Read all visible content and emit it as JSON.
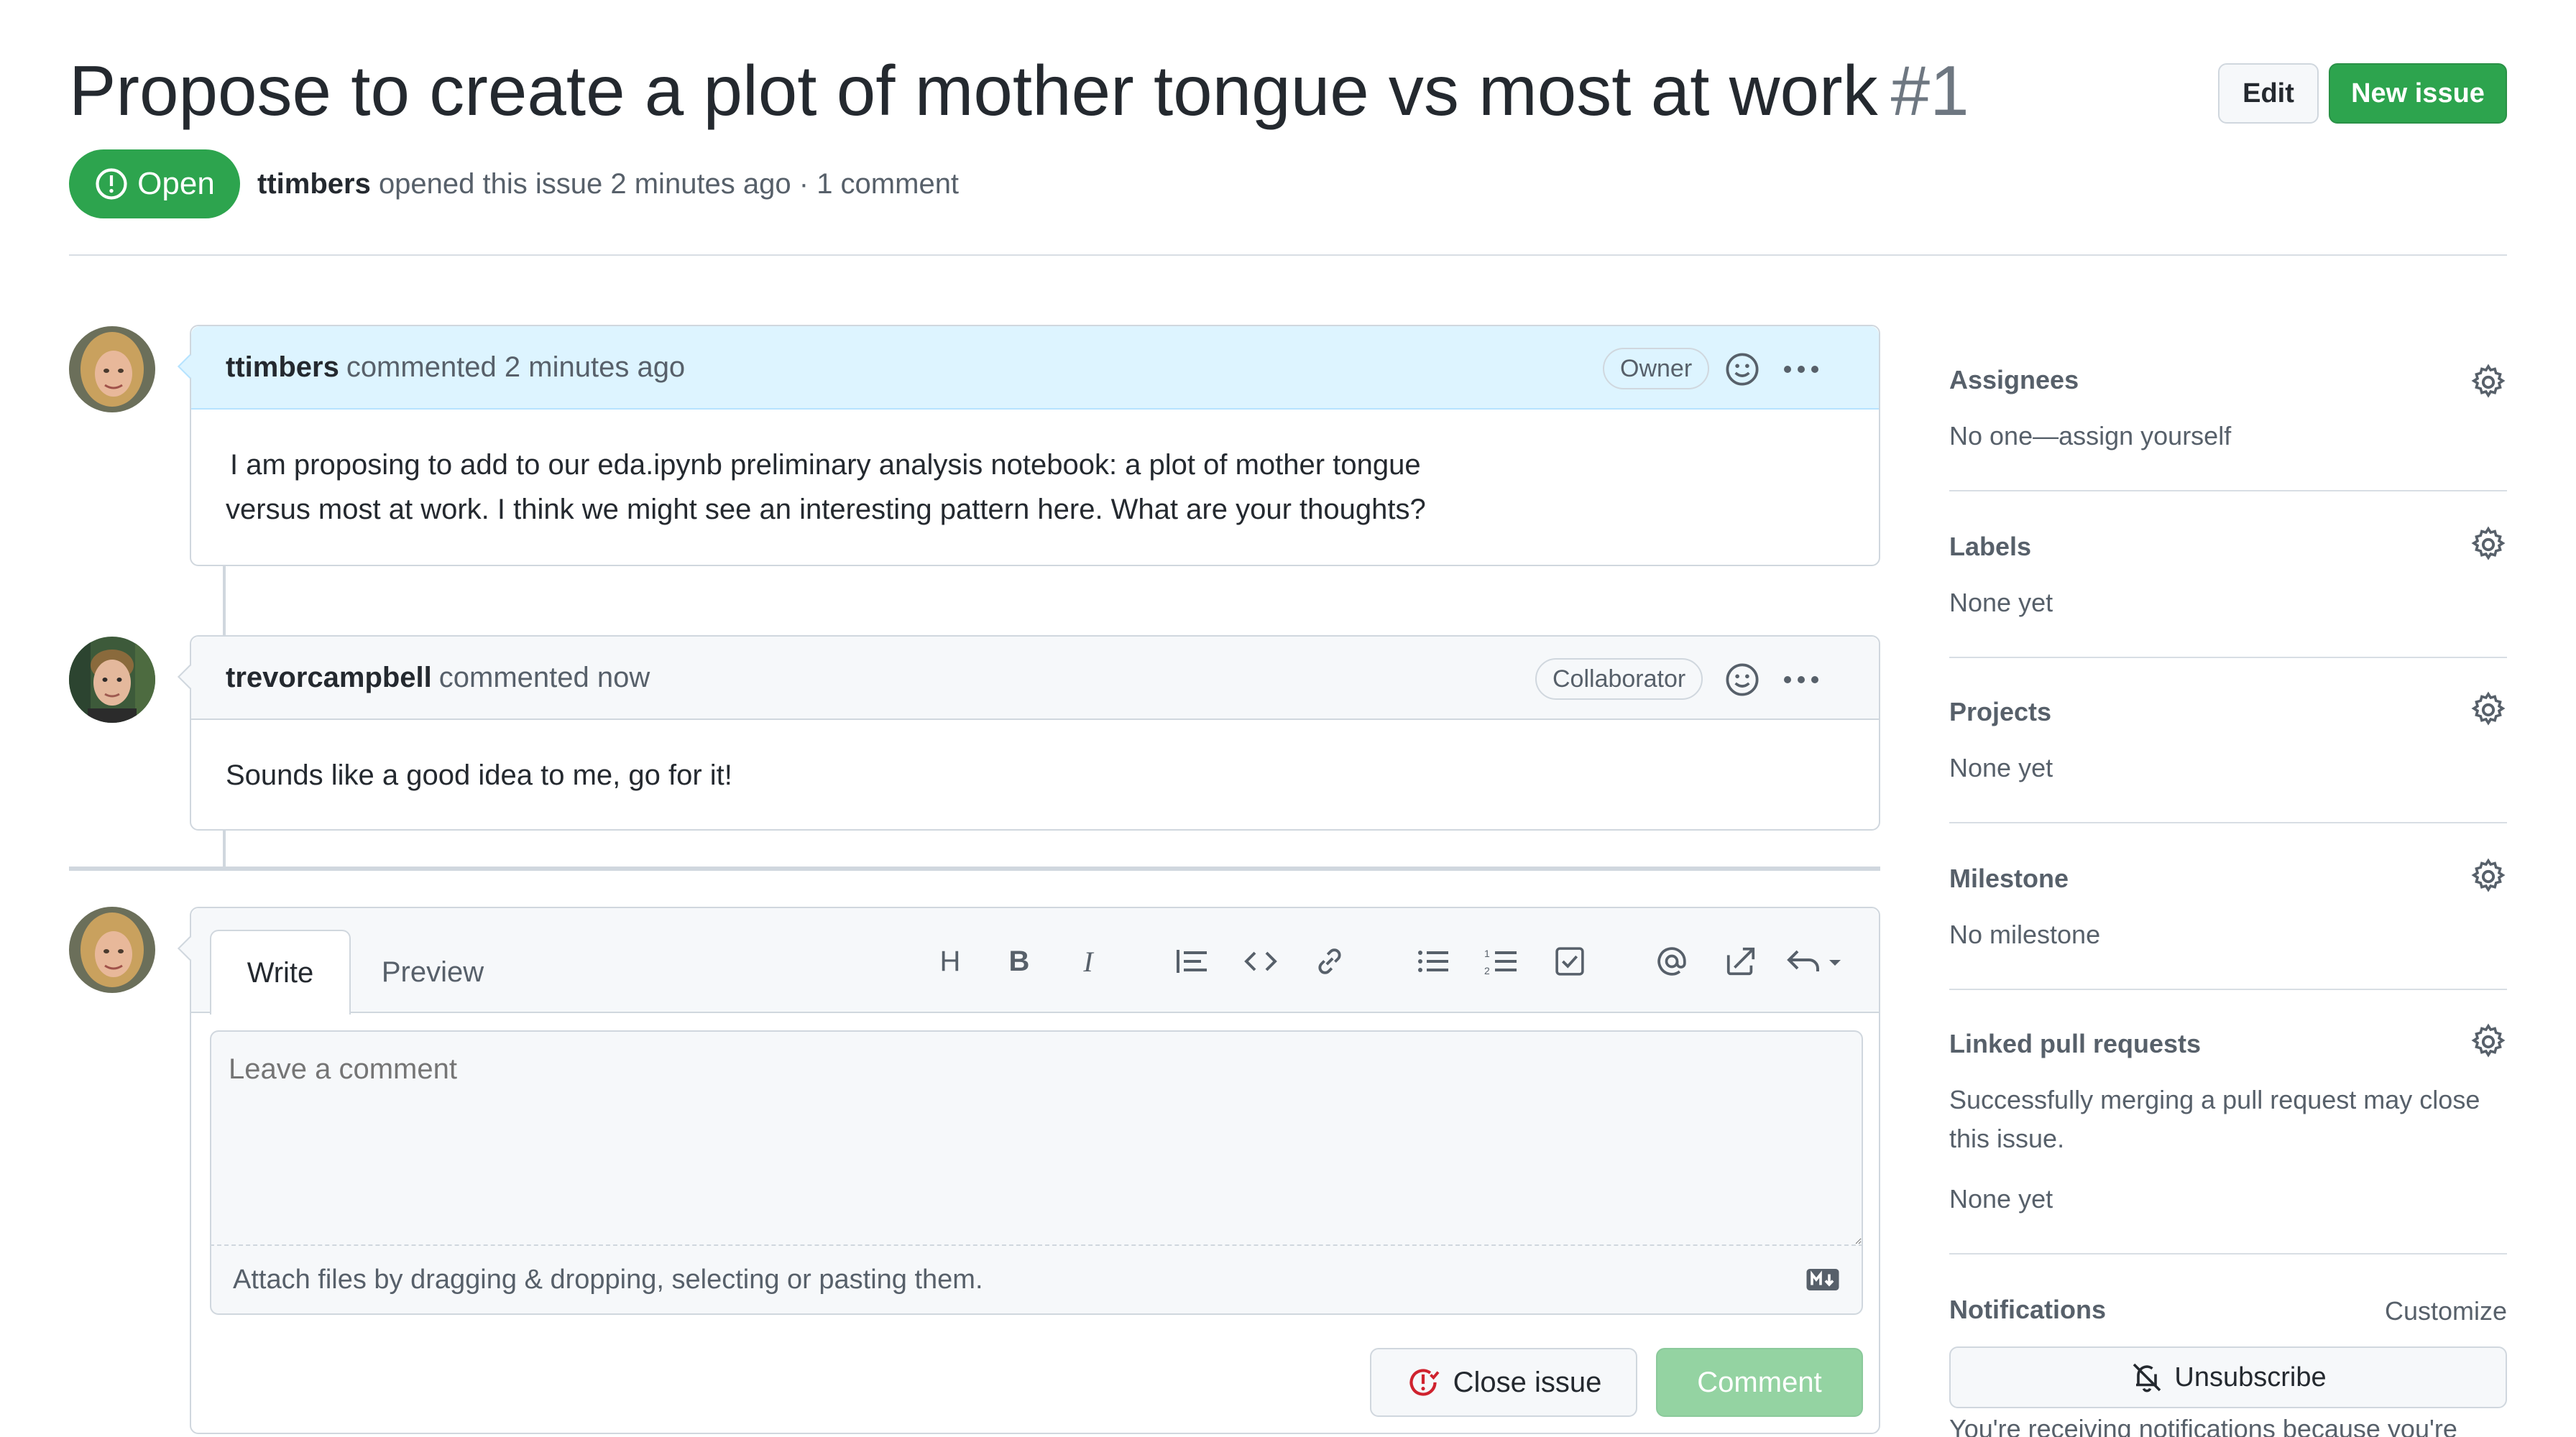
{
  "issue": {
    "title": "Propose to create a plot of mother tongue vs most at work",
    "number": "#1",
    "state": "Open",
    "author": "ttimbers",
    "meta_text": "opened this issue 2 minutes ago · 1 comment"
  },
  "header": {
    "edit_label": "Edit",
    "new_issue_label": "New issue"
  },
  "comments": [
    {
      "author": "ttimbers",
      "action": "commented 2 minutes ago",
      "role": "Owner",
      "body_line1": "I am proposing to add to our eda.ipynb preliminary analysis notebook: a plot of mother tongue",
      "body_line2": "versus most at work. I think we might see an interesting pattern here. What are your thoughts?"
    },
    {
      "author": "trevorcampbell",
      "action": "commented now",
      "role": "Collaborator",
      "body": "Sounds like a good idea to me, go for it!"
    }
  ],
  "editor": {
    "tab_write": "Write",
    "tab_preview": "Preview",
    "tool_heading": "H",
    "tool_bold": "B",
    "tool_italic": "I",
    "placeholder": "Leave a comment",
    "attach_text": "Attach files by dragging & dropping, selecting or pasting them.",
    "close_label": "Close issue",
    "comment_label": "Comment"
  },
  "sidebar": {
    "assignees_label": "Assignees",
    "assignees_value": "No one—assign yourself",
    "labels_label": "Labels",
    "labels_value": "None yet",
    "projects_label": "Projects",
    "projects_value": "None yet",
    "milestone_label": "Milestone",
    "milestone_value": "No milestone",
    "linked_label": "Linked pull requests",
    "linked_desc_line1": "Successfully merging a pull request may close",
    "linked_desc_line2": "this issue.",
    "linked_value": "None yet",
    "notifications_label": "Notifications",
    "customize_label": "Customize",
    "unsubscribe_label": "Unsubscribe",
    "notif_note": "You're receiving notifications because you're"
  },
  "colors": {
    "green": "#2da44e",
    "owner_header_bg": "#ddf4ff",
    "border": "#d0d7de",
    "muted_text": "#57606a"
  }
}
